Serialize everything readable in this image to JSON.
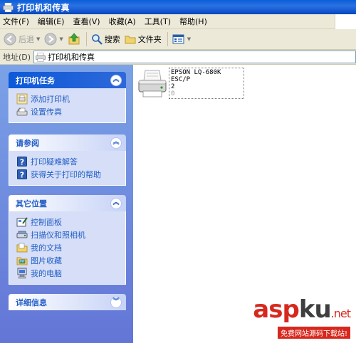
{
  "window": {
    "title": "打印机和传真"
  },
  "menu": [
    {
      "label": "文件(F)"
    },
    {
      "label": "编辑(E)"
    },
    {
      "label": "查看(V)"
    },
    {
      "label": "收藏(A)"
    },
    {
      "label": "工具(T)"
    },
    {
      "label": "帮助(H)"
    }
  ],
  "toolbar": {
    "back_label": "后退",
    "search_label": "搜索",
    "folders_label": "文件夹"
  },
  "address": {
    "label": "地址(D)",
    "value": "打印机和传真"
  },
  "panels": {
    "printer_tasks": {
      "title": "打印机任务",
      "items": [
        {
          "label": "添加打印机",
          "icon": "add-printer-icon"
        },
        {
          "label": "设置传真",
          "icon": "fax-icon"
        }
      ]
    },
    "see_also": {
      "title": "请参阅",
      "items": [
        {
          "label": "打印疑难解答",
          "icon": "help-icon"
        },
        {
          "label": "获得关于打印的帮助",
          "icon": "help-icon"
        }
      ]
    },
    "other_places": {
      "title": "其它位置",
      "items": [
        {
          "label": "控制面板",
          "icon": "control-panel-icon"
        },
        {
          "label": "扫描仪和照相机",
          "icon": "scanner-icon"
        },
        {
          "label": "我的文档",
          "icon": "folder-icon"
        },
        {
          "label": "图片收藏",
          "icon": "pictures-icon"
        },
        {
          "label": "我的电脑",
          "icon": "computer-icon"
        }
      ]
    },
    "details": {
      "title": "详细信息"
    }
  },
  "printers": [
    {
      "name": "EPSON LQ-680K ESC/P",
      "line2": "2",
      "status": "0"
    }
  ],
  "watermark": {
    "main_1": "asp",
    "main_2": "ku",
    "suffix": ".net",
    "sub": "免费网站源码下载站!"
  },
  "colors": {
    "title_blue": "#0a5fd8",
    "pane_blue": "#7ba2e7",
    "link_blue": "#215dc6",
    "watermark_red": "#d7281e"
  }
}
